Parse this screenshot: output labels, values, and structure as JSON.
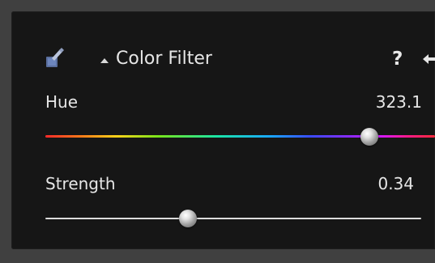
{
  "panel": {
    "title": "Color Filter",
    "help_label": "?"
  },
  "params": [
    {
      "label": "Hue",
      "value": "323.1",
      "position_fraction": 0.832
    },
    {
      "label": "Strength",
      "value": "0.34",
      "position_fraction": 0.38
    }
  ],
  "icons": {
    "brush": "brush-icon",
    "collapse": "triangle-up-icon",
    "help": "help-icon",
    "reset": "reset-arrow-icon"
  },
  "colors": {
    "panel_bg": "#161616",
    "frame_bg": "#404040",
    "text": "#e6e6e6",
    "knob": "#cfcfcf"
  }
}
